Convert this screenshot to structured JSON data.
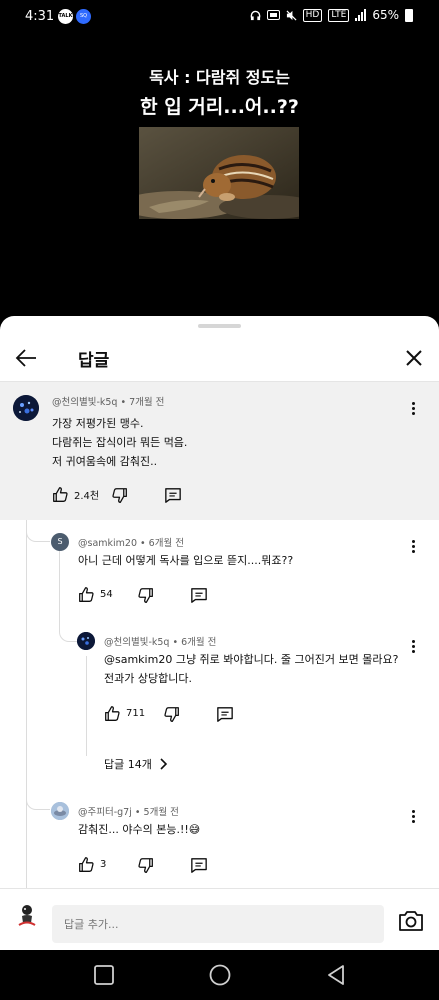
{
  "status_bar": {
    "time": "4:31",
    "talk_badge": "TALK",
    "sq_badge": "SQ",
    "hd_label": "HD",
    "lte_label": "LTE",
    "battery": "65%"
  },
  "video": {
    "caption_line1": "독사 : 다람쥐 정도는",
    "caption_line2": "한 입 거리...어..??"
  },
  "sheet": {
    "title": "답글",
    "back_icon": "arrow-left-icon",
    "close_icon": "close-icon"
  },
  "parent_comment": {
    "author": "@천의별빛-k5q",
    "time": "7개월 전",
    "lines": [
      "가장 저평가된 맹수.",
      "다람쥐는 잡식이라 뭐든 먹음.",
      "저 귀여움속에 감춰진.."
    ],
    "likes": "2.4천"
  },
  "replies": [
    {
      "author": "@samkim20",
      "time": "6개월 전",
      "avatar_letter": "S",
      "lines": [
        "아니 근데 어떻게 독사를 입으로 뜯지....뭐죠??"
      ],
      "likes": "54"
    },
    {
      "author": "@천의별빛-k5q",
      "time": "6개월 전",
      "lines": [
        "@samkim20  그냥 쥐로 봐야합니다. 줄 그어진거 보면 몰라요?",
        "전과가 상당합니다."
      ],
      "likes": "711"
    },
    {
      "author": "@주피터-g7j",
      "time": "5개월 전",
      "lines": [
        "감춰진... 야수의 본능.!!😅"
      ],
      "likes": "3"
    }
  ],
  "more_replies_label": "답글 14개",
  "reply_bar": {
    "placeholder": "답글 추가..."
  },
  "colors": {
    "sheet_bg": "#ffffff",
    "highlight_bg": "#f1f1f1",
    "text": "#0f0f0f",
    "meta": "#606060"
  }
}
